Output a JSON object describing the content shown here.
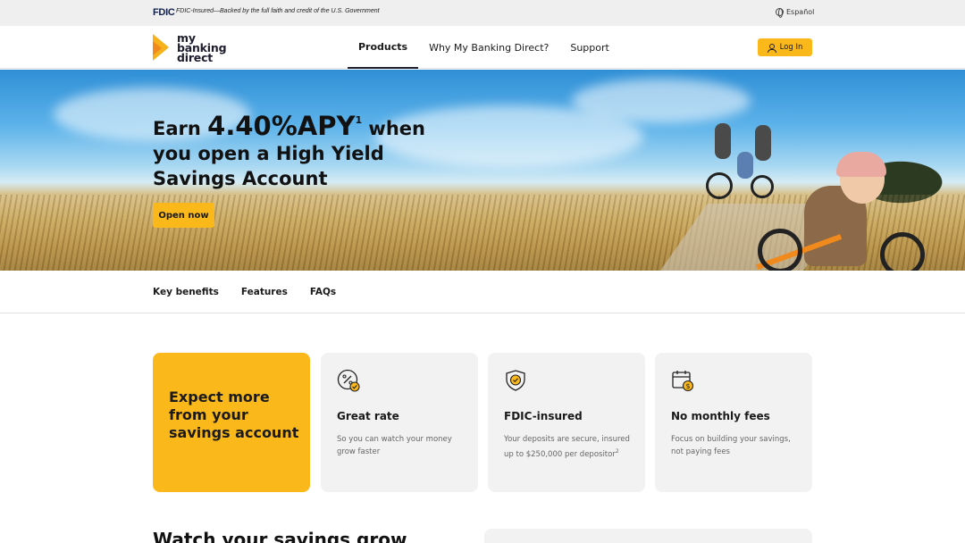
{
  "fdic_bar": {
    "logo": "FDIC",
    "notice": "FDIC-Insured—Backed by the full faith and credit of the U.S. Government",
    "language": "Español"
  },
  "header": {
    "logo_line1": "my",
    "logo_line2": "banking",
    "logo_line3": "direct",
    "nav": [
      {
        "label": "Products",
        "active": true
      },
      {
        "label": "Why My Banking Direct?",
        "active": false
      },
      {
        "label": "Support",
        "active": false
      }
    ],
    "login_label": "Log In"
  },
  "hero": {
    "prefix": "Earn ",
    "rate": "4.40%APY",
    "footnote": "1",
    "suffix": " when you open a High Yield Savings Account",
    "cta": "Open now"
  },
  "subnav": {
    "items": [
      "Key benefits",
      "Features",
      "FAQs"
    ]
  },
  "cards": {
    "feature_text": "Expect more from your savings account",
    "items": [
      {
        "icon": "percent-icon",
        "title": "Great rate",
        "desc": "So you can watch your money grow faster",
        "footnote": ""
      },
      {
        "icon": "shield-icon",
        "title": "FDIC-insured",
        "desc": "Your deposits are secure, insured up to $250,000 per depositor",
        "footnote": "2"
      },
      {
        "icon": "calendar-dollar-icon",
        "title": "No monthly fees",
        "desc": "Focus on building your savings, not paying fees",
        "footnote": ""
      }
    ]
  },
  "bottom": {
    "heading": "Watch your savings grow"
  },
  "colors": {
    "accent": "#fbb81a",
    "card_bg": "#f2f2f2"
  }
}
